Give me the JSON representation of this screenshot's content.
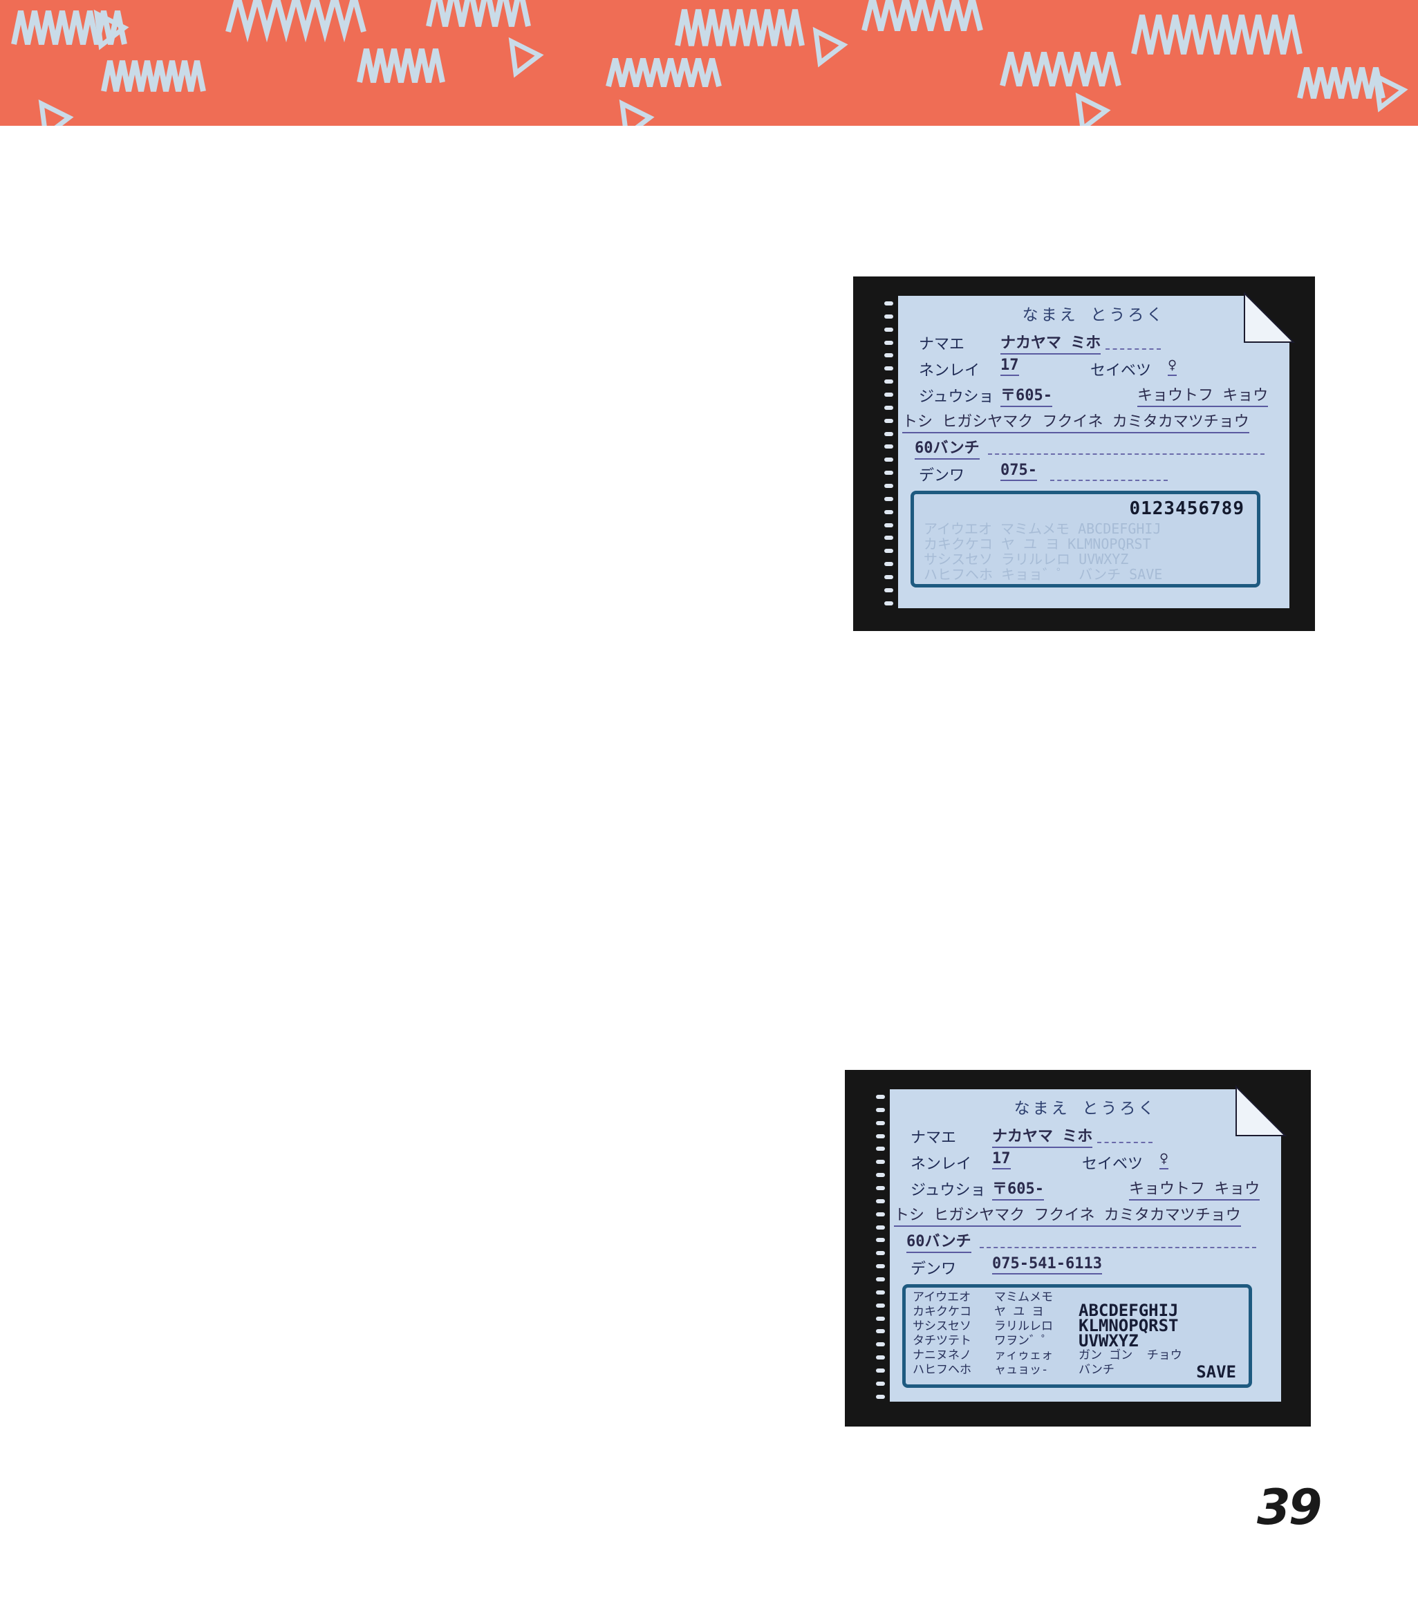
{
  "page": {
    "number": "39"
  },
  "banner": {
    "color": "#ef6d55",
    "pattern_color": "#c9dbe8"
  },
  "screen_1": {
    "title": "なまえ とうろく",
    "name_label": "ナマエ",
    "name_value": "ナカヤマ ミホ",
    "age_label": "ネンレイ",
    "age_value": "17",
    "sex_label": "セイベツ",
    "sex_value": "♀",
    "address_label": "ジュウショ",
    "postal_value": "〒605-",
    "address_line_1": "キョウトフ キョウ",
    "address_line_2": "トシ ヒガシヤマク フクイネ カミタカマツチョウ",
    "address_line_3": "60バンチ",
    "phone_label": "デンワ",
    "phone_value": "075-",
    "keypad_digits": "0123456789",
    "keypad_faint_1": "アイウエオ マミムメモ ABCDEFGHIJ",
    "keypad_faint_2": "カキクケコ ヤ ユ ヨ KLMNOPQRST",
    "keypad_faint_3": "サシスセソ ラリルレロ UVWXYZ",
    "keypad_faint_4": "ハヒフヘホ キョョ゛゜ バンチ SAVE"
  },
  "screen_2": {
    "title": "なまえ とうろく",
    "name_label": "ナマエ",
    "name_value": "ナカヤマ ミホ",
    "age_label": "ネンレイ",
    "age_value": "17",
    "sex_label": "セイベツ",
    "sex_value": "♀",
    "address_label": "ジュウショ",
    "postal_value": "〒605-",
    "address_line_1": "キョウトフ キョウ",
    "address_line_2": "トシ ヒガシヤマク フクイネ カミタカマツチョウ",
    "address_line_3": "60バンチ",
    "phone_label": "デンワ",
    "phone_value": "075-541-6113",
    "kana_col_1": "アイウエオ\nカキクケコ\nサシスセソ\nタチツテト\nナニヌネノ\nハヒフヘホ",
    "kana_col_2": "マミムメモ\nヤ ユ ヨ\nラリルレロ\nワヲン゛゜\nァィゥェォ\nャュョッ-",
    "kana_col_3": "\n\n\n\nガン ゴン  チョウ\nバンチ",
    "alpha_rows": "ABCDEFGHIJ\nKLMNOPQRST\nUVWXYZ",
    "save_label": "SAVE"
  }
}
